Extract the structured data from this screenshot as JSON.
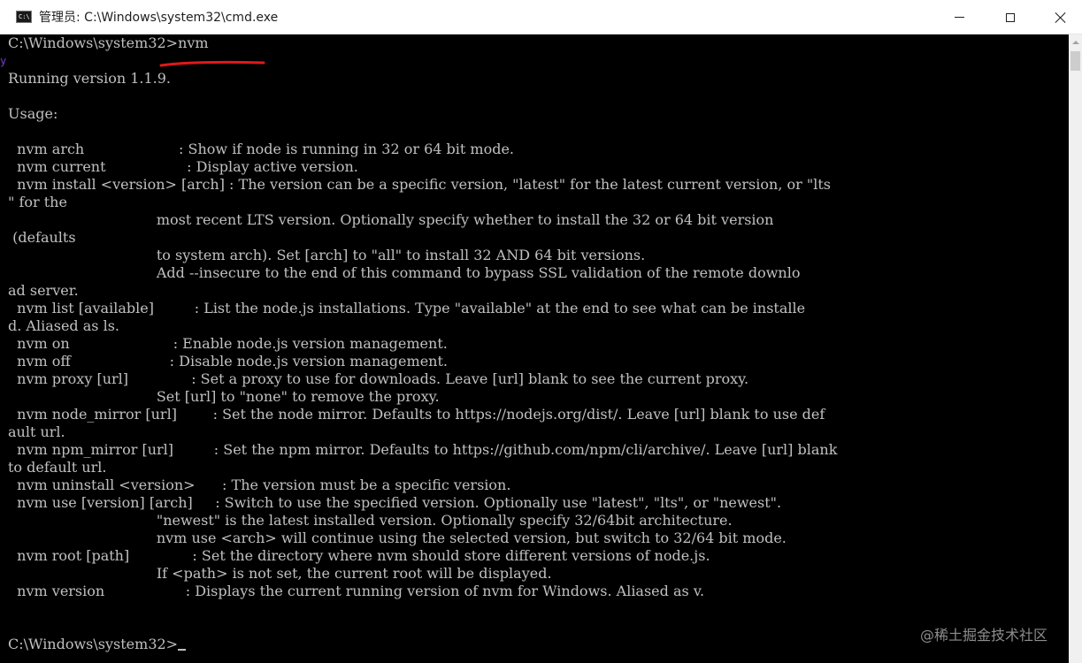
{
  "window": {
    "title": "管理员: C:\\Windows\\system32\\cmd.exe",
    "app_icon_text": "C:\\"
  },
  "console": {
    "lines": [
      "C:\\Windows\\system32>nvm",
      "",
      "Running version 1.1.9.",
      "",
      "Usage:",
      "",
      "  nvm arch                     : Show if node is running in 32 or 64 bit mode.",
      "  nvm current                  : Display active version.",
      "  nvm install <version> [arch] : The version can be a specific version, \"latest\" for the latest current version, or \"lts",
      "\" for the",
      "                                 most recent LTS version. Optionally specify whether to install the 32 or 64 bit version",
      " (defaults",
      "                                 to system arch). Set [arch] to \"all\" to install 32 AND 64 bit versions.",
      "                                 Add --insecure to the end of this command to bypass SSL validation of the remote downlo",
      "ad server.",
      "  nvm list [available]         : List the node.js installations. Type \"available\" at the end to see what can be installe",
      "d. Aliased as ls.",
      "  nvm on                       : Enable node.js version management.",
      "  nvm off                      : Disable node.js version management.",
      "  nvm proxy [url]              : Set a proxy to use for downloads. Leave [url] blank to see the current proxy.",
      "                                 Set [url] to \"none\" to remove the proxy.",
      "  nvm node_mirror [url]        : Set the node mirror. Defaults to https://nodejs.org/dist/. Leave [url] blank to use def",
      "ault url.",
      "  nvm npm_mirror [url]         : Set the npm mirror. Defaults to https://github.com/npm/cli/archive/. Leave [url] blank",
      "to default url.",
      "  nvm uninstall <version>      : The version must be a specific version.",
      "  nvm use [version] [arch]     : Switch to use the specified version. Optionally use \"latest\", \"lts\", or \"newest\".",
      "                                 \"newest\" is the latest installed version. Optionally specify 32/64bit architecture.",
      "                                 nvm use <arch> will continue using the selected version, but switch to 32/64 bit mode.",
      "  nvm root [path]              : Set the directory where nvm should store different versions of node.js.",
      "                                 If <path> is not set, the current root will be displayed.",
      "  nvm version                  : Displays the current running version of nvm for Windows. Aliased as v.",
      "",
      ""
    ],
    "prompt": "C:\\Windows\\system32>"
  },
  "annotation": {
    "edge_mark": "y"
  },
  "watermark": "@稀土掘金技术社区",
  "colors": {
    "console_bg": "#000000",
    "console_text": "#c0c0c0",
    "annotation_red": "#e0191c"
  }
}
